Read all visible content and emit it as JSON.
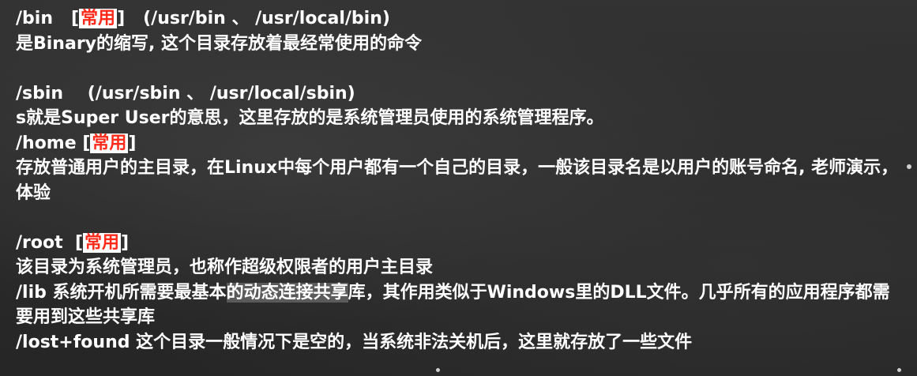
{
  "bin": {
    "path": "/bin",
    "open": "[",
    "tag": "常用",
    "close": "]",
    "alt": "(/usr/bin 、 /usr/local/bin)",
    "desc": "是Binary的缩写, 这个目录存放着最经常使用的命令"
  },
  "sbin": {
    "path": "/sbin",
    "alt": "(/usr/sbin 、 /usr/local/sbin)",
    "desc": "s就是Super User的意思，这里存放的是系统管理员使用的系统管理程序。"
  },
  "home": {
    "path": "/home",
    "open": "[",
    "tag": "常用",
    "close": "]",
    "desc": "存放普通用户的主目录，在Linux中每个用户都有一个自己的目录，一般该目录名是以用户的账号命名, 老师演示，体验"
  },
  "root": {
    "path": "/root",
    "open": "[",
    "tag": "常用",
    "close": "]",
    "desc": "该目录为系统管理员，也称作超级权限者的用户主目录"
  },
  "lib": {
    "path": "/lib",
    "desc_a": "系统开机所需要最基本",
    "desc_b": "的动态连接共享",
    "desc_c": "库，其作用类似于Windows里的DLL文件。几乎所有的应用程序都需要用到这些共享库"
  },
  "lost_found": {
    "path": "/lost+found",
    "desc": "这个目录一般情况下是空的，当系统非法关机后，这里就存放了一些文件"
  }
}
